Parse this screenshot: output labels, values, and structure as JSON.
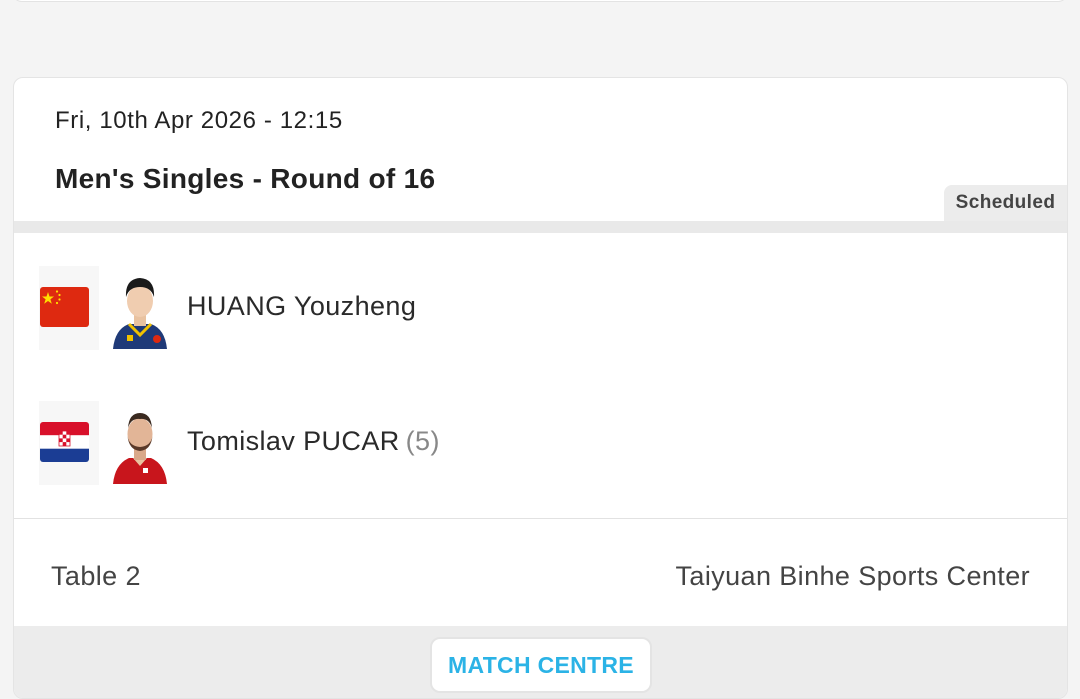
{
  "match": {
    "datetime": "Fri, 10th Apr 2026 - 12:15",
    "event": "Men's Singles - Round of 16",
    "status": "Scheduled",
    "players": [
      {
        "name": "HUANG Youzheng",
        "seed": "",
        "country": "China",
        "flag_icon": "china-flag-icon"
      },
      {
        "name": "Tomislav PUCAR",
        "seed": "(5)",
        "country": "Croatia",
        "flag_icon": "croatia-flag-icon"
      }
    ],
    "table": "Table 2",
    "venue": "Taiyuan Binhe Sports Center",
    "match_centre_label": "MATCH CENTRE"
  },
  "colors": {
    "accent": "#2bb3e6",
    "china_red": "#de2910",
    "croatia_red": "#d8102a",
    "croatia_blue": "#1b3d94"
  }
}
